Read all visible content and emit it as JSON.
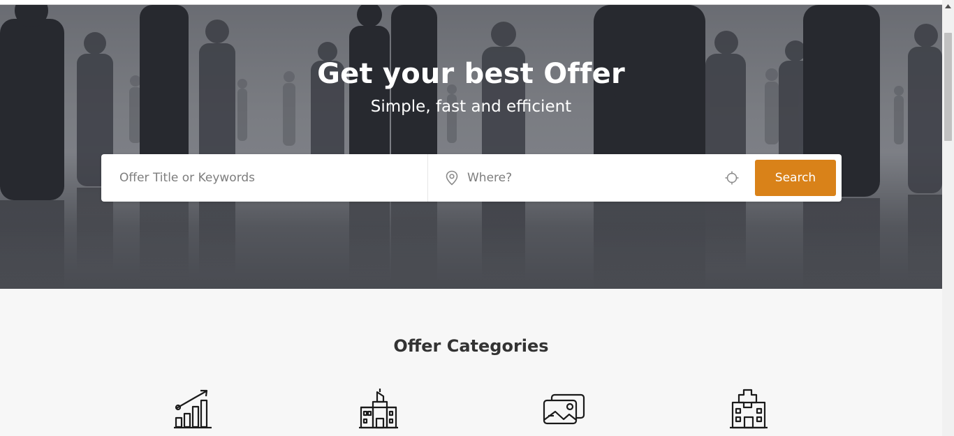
{
  "hero": {
    "title": "Get your best Offer",
    "subtitle": "Simple, fast and efficient"
  },
  "search": {
    "keywords_placeholder": "Offer Title or Keywords",
    "keywords_value": "",
    "location_placeholder": "Where?",
    "location_value": "",
    "button_label": "Search",
    "pin_icon": "location-pin-icon",
    "locate_icon": "crosshair-locate-icon"
  },
  "categories": {
    "title": "Offer Categories",
    "icons": [
      "growth-chart-icon",
      "building-icon",
      "image-gallery-icon",
      "hospital-icon"
    ]
  },
  "colors": {
    "accent": "#d98219",
    "text_dark": "#333333",
    "page_bg": "#f7f7f7"
  }
}
